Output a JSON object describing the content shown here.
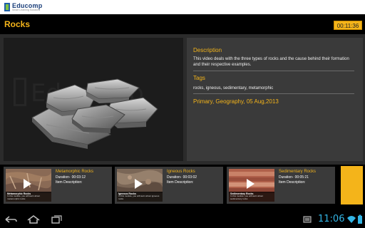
{
  "brand": {
    "name": "Educomp",
    "tagline": "Smart Learning Solutions"
  },
  "header": {
    "title": "Rocks",
    "timer": "00:11:36"
  },
  "video": {
    "watermark": "Educomp"
  },
  "details": {
    "description_heading": "Description",
    "description_text": "This video deals with the three types of rocks and the cause behind their formation and their respective examples.",
    "tags_heading": "Tags",
    "tags_text": "rocks, igneous, sedimentary, metamorphic",
    "meta": "Primary, Geography, 05 Aug,2013"
  },
  "related": [
    {
      "title": "Metamorphic Rocks",
      "duration_label": "Duration-",
      "duration": "00:03:12",
      "item_desc_label": "Item Description:",
      "thumb_title": "Metamorphic Rocks",
      "thumb_desc": "In this module, you will learn about metamorphic rocks"
    },
    {
      "title": "Igneous Rocks",
      "duration_label": "Duration-",
      "duration": "00:03:02",
      "item_desc_label": "Item Description:",
      "thumb_title": "Igneous Rocks",
      "thumb_desc": "In this module, you will learn about igneous rocks"
    },
    {
      "title": "Sedimentary Rocks",
      "duration_label": "Duration-",
      "duration": "00:05:21",
      "item_desc_label": "Item Description:",
      "thumb_title": "Sedimentary Rocks",
      "thumb_desc": "In this module, you will learn about sedimentary rocks"
    }
  ],
  "status": {
    "clock": "11:06"
  },
  "colors": {
    "accent": "#f4b41a",
    "panel": "#3a3a3a",
    "clock": "#33b5e5"
  }
}
